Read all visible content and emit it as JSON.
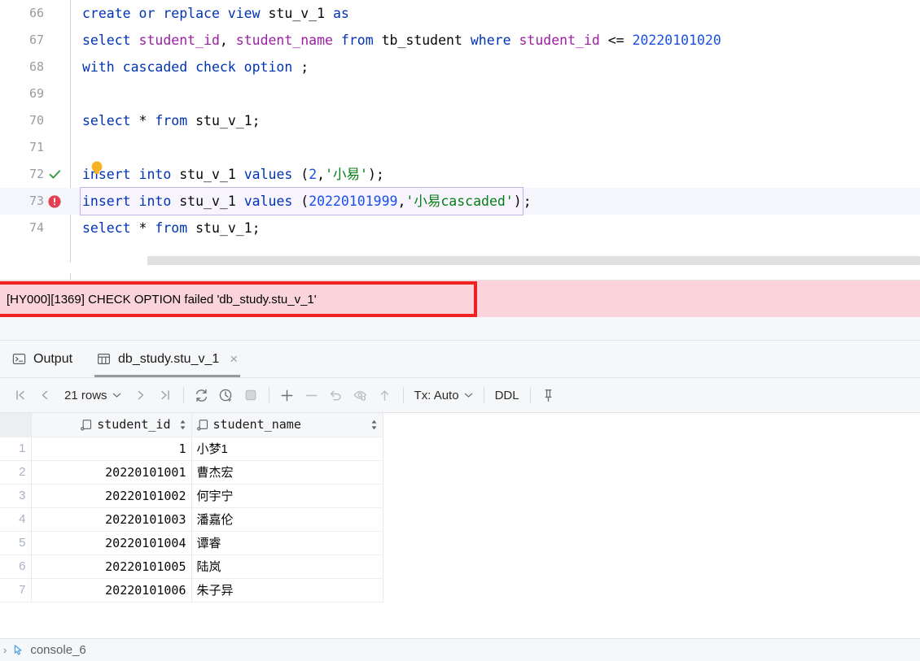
{
  "editor": {
    "lines": [
      {
        "number": "66",
        "marker": "none",
        "tokens": [
          {
            "t": "create or replace view ",
            "c": "kw"
          },
          {
            "t": "stu_v_1 ",
            "c": "plain"
          },
          {
            "t": "as",
            "c": "kw"
          }
        ]
      },
      {
        "number": "67",
        "marker": "none",
        "tokens": [
          {
            "t": "select ",
            "c": "kw"
          },
          {
            "t": "student_id",
            "c": "col"
          },
          {
            "t": ", ",
            "c": "plain"
          },
          {
            "t": "student_name ",
            "c": "col"
          },
          {
            "t": "from ",
            "c": "kw"
          },
          {
            "t": "tb_student ",
            "c": "plain"
          },
          {
            "t": "where ",
            "c": "kw"
          },
          {
            "t": "student_id ",
            "c": "col"
          },
          {
            "t": "<= ",
            "c": "plain"
          },
          {
            "t": "20220101020",
            "c": "num"
          }
        ]
      },
      {
        "number": "68",
        "marker": "none",
        "tokens": [
          {
            "t": "with cascaded check option ",
            "c": "kw"
          },
          {
            "t": ";",
            "c": "plain"
          }
        ]
      },
      {
        "number": "69",
        "marker": "none",
        "tokens": []
      },
      {
        "number": "70",
        "marker": "none",
        "tokens": [
          {
            "t": "select ",
            "c": "kw"
          },
          {
            "t": "* ",
            "c": "plain"
          },
          {
            "t": "from ",
            "c": "kw"
          },
          {
            "t": "stu_v_1;",
            "c": "plain"
          }
        ]
      },
      {
        "number": "71",
        "marker": "none",
        "tokens": []
      },
      {
        "number": "72",
        "marker": "success",
        "tokens": [
          {
            "t": "insert into ",
            "c": "kw"
          },
          {
            "t": "stu_v_1 ",
            "c": "plain"
          },
          {
            "t": "values ",
            "c": "kw"
          },
          {
            "t": "(",
            "c": "plain"
          },
          {
            "t": "2",
            "c": "num"
          },
          {
            "t": ",",
            "c": "plain"
          },
          {
            "t": "'小易'",
            "c": "str"
          },
          {
            "t": ");",
            "c": "plain"
          }
        ]
      },
      {
        "number": "73",
        "marker": "error",
        "current": true,
        "boxed": true,
        "tokens": [
          {
            "t": "insert into ",
            "c": "kw"
          },
          {
            "t": "stu_v_1 ",
            "c": "plain"
          },
          {
            "t": "values ",
            "c": "kw"
          },
          {
            "t": "(",
            "c": "plain"
          },
          {
            "t": "20220101999",
            "c": "num"
          },
          {
            "t": ",",
            "c": "plain"
          },
          {
            "t": "'小易cascaded'",
            "c": "str"
          },
          {
            "t": ")",
            "c": "plain"
          }
        ],
        "after_box": ";"
      },
      {
        "number": "74",
        "marker": "none",
        "tokens": [
          {
            "t": "select ",
            "c": "kw"
          },
          {
            "t": "* ",
            "c": "plain"
          },
          {
            "t": "from ",
            "c": "kw"
          },
          {
            "t": "stu_v_1;",
            "c": "plain"
          }
        ]
      }
    ]
  },
  "error_banner": {
    "message": "[HY000][1369] CHECK OPTION failed 'db_study.stu_v_1'",
    "border_color": "#ef2222",
    "background_color": "#fad4da"
  },
  "tabs": [
    {
      "label": "Output",
      "icon": "console-icon",
      "active": false,
      "closable": false
    },
    {
      "label": "db_study.stu_v_1",
      "icon": "table-icon",
      "active": true,
      "closable": true,
      "close_glyph": "×"
    }
  ],
  "toolbar": {
    "first_page_icon": "first-page-icon",
    "prev_page_icon": "prev-page-icon",
    "rows_label": "21 rows",
    "rows_chevron": "⌄",
    "next_page_icon": "next-page-icon",
    "last_page_icon": "last-page-icon",
    "refresh_icon": "refresh-icon",
    "history_icon": "clock-history-icon",
    "stop_icon": "stop-icon",
    "add_row_icon": "plus-icon",
    "remove_row_icon": "minus-icon",
    "revert_icon": "undo-icon",
    "view_query_icon": "preview-icon",
    "submit_icon": "upload-arrow-icon",
    "tx_label": "Tx: Auto",
    "tx_chevron": "⌄",
    "ddl_label": "DDL",
    "pin_icon": "pin-icon"
  },
  "grid": {
    "columns": [
      {
        "label": "student_id",
        "icon": "column-icon",
        "sort": "↕"
      },
      {
        "label": "student_name",
        "icon": "column-icon",
        "sort": "↕"
      }
    ],
    "rows": [
      {
        "n": "1",
        "student_id": "1",
        "student_name": "小梦1"
      },
      {
        "n": "2",
        "student_id": "20220101001",
        "student_name": "曹杰宏"
      },
      {
        "n": "3",
        "student_id": "20220101002",
        "student_name": "何宇宁"
      },
      {
        "n": "4",
        "student_id": "20220101003",
        "student_name": "潘嘉伦"
      },
      {
        "n": "5",
        "student_id": "20220101004",
        "student_name": "谭睿"
      },
      {
        "n": "6",
        "student_id": "20220101005",
        "student_name": "陆岚"
      },
      {
        "n": "7",
        "student_id": "20220101006",
        "student_name": "朱子异"
      }
    ]
  },
  "statusbar": {
    "chevron": "›",
    "icon": "cursor-icon",
    "label": "console_6"
  }
}
